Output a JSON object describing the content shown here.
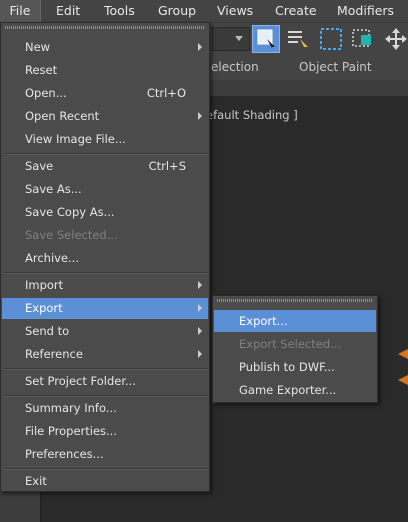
{
  "menubar": {
    "items": [
      "File",
      "Edit",
      "Tools",
      "Group",
      "Views",
      "Create",
      "Modifiers"
    ]
  },
  "ribbon": {
    "selection_label": "Selection",
    "selection_label_visible": "election",
    "object_paint_label": "Object Paint"
  },
  "viewport": {
    "shading_label": "Default Shading ]",
    "shading_label_visible": "efault Shading ]"
  },
  "file_menu": {
    "items": [
      {
        "label": "New",
        "shortcut": "",
        "submenu": true,
        "state": "normal"
      },
      {
        "label": "Reset",
        "shortcut": "",
        "submenu": false,
        "state": "normal"
      },
      {
        "label": "Open...",
        "shortcut": "Ctrl+O",
        "submenu": false,
        "state": "normal"
      },
      {
        "label": "Open Recent",
        "shortcut": "",
        "submenu": true,
        "state": "normal"
      },
      {
        "label": "View Image File...",
        "shortcut": "",
        "submenu": false,
        "state": "normal"
      },
      {
        "label": "Save",
        "shortcut": "Ctrl+S",
        "submenu": false,
        "state": "normal"
      },
      {
        "label": "Save As...",
        "shortcut": "",
        "submenu": false,
        "state": "normal"
      },
      {
        "label": "Save Copy As...",
        "shortcut": "",
        "submenu": false,
        "state": "normal"
      },
      {
        "label": "Save Selected...",
        "shortcut": "",
        "submenu": false,
        "state": "disabled"
      },
      {
        "label": "Archive...",
        "shortcut": "",
        "submenu": false,
        "state": "normal"
      },
      {
        "label": "Import",
        "shortcut": "",
        "submenu": true,
        "state": "normal"
      },
      {
        "label": "Export",
        "shortcut": "",
        "submenu": true,
        "state": "active"
      },
      {
        "label": "Send to",
        "shortcut": "",
        "submenu": true,
        "state": "normal"
      },
      {
        "label": "Reference",
        "shortcut": "",
        "submenu": true,
        "state": "normal"
      },
      {
        "label": "Set Project Folder...",
        "shortcut": "",
        "submenu": false,
        "state": "normal"
      },
      {
        "label": "Summary Info...",
        "shortcut": "",
        "submenu": false,
        "state": "normal"
      },
      {
        "label": "File Properties...",
        "shortcut": "",
        "submenu": false,
        "state": "normal"
      },
      {
        "label": "Preferences...",
        "shortcut": "",
        "submenu": false,
        "state": "normal"
      },
      {
        "label": "Exit",
        "shortcut": "",
        "submenu": false,
        "state": "normal"
      }
    ]
  },
  "export_submenu": {
    "items": [
      {
        "label": "Export...",
        "state": "active"
      },
      {
        "label": "Export Selected...",
        "state": "disabled"
      },
      {
        "label": "Publish to DWF...",
        "state": "normal"
      },
      {
        "label": "Game Exporter...",
        "state": "normal"
      }
    ]
  },
  "colors": {
    "highlight": "#5b8fd6",
    "menu_bg": "#4b4b4b",
    "gizmo_orange": "#d9761c"
  }
}
